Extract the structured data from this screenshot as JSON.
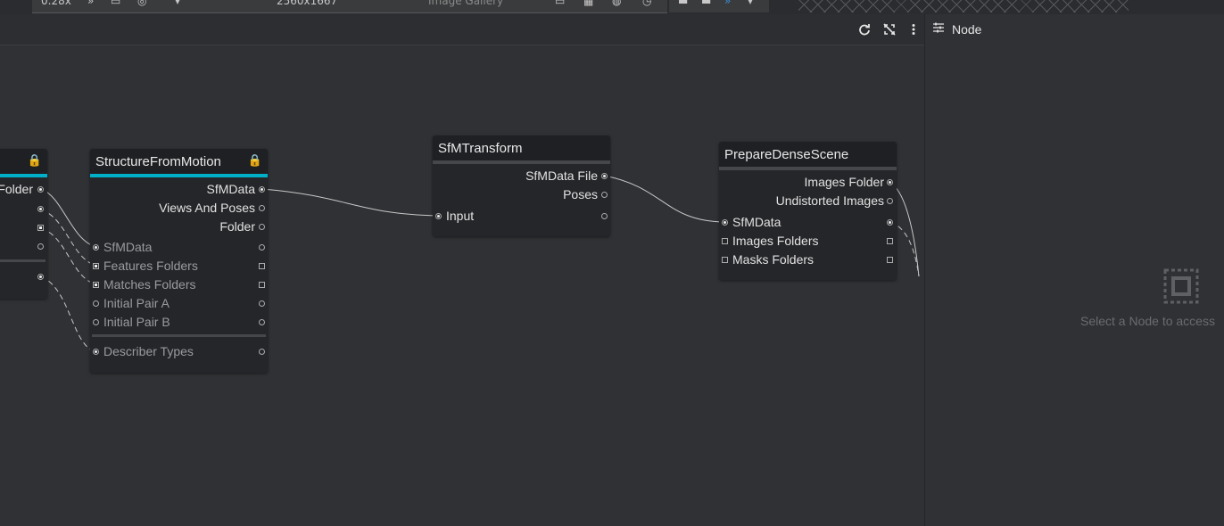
{
  "top_strip": {
    "zoom": "0.28x",
    "resolution": "2560x1667",
    "gallery_label": "Image Gallery"
  },
  "header": {
    "icons": [
      "refresh-icon",
      "link-off-icon",
      "more-vert-icon"
    ]
  },
  "right_panel": {
    "title": "Node",
    "title_icon": "tune-icon",
    "placeholder": "Select a Node to access"
  },
  "nodes": {
    "partial": {
      "outputs": [
        "Folder"
      ]
    },
    "sfm": {
      "title": "StructureFromMotion",
      "outputs": [
        "SfMData",
        "Views And Poses",
        "Folder"
      ],
      "inputs": [
        "SfMData",
        "Features Folders",
        "Matches Folders",
        "Initial Pair A",
        "Initial Pair B"
      ],
      "extra_inputs": [
        "Describer Types"
      ]
    },
    "transform": {
      "title": "SfMTransform",
      "outputs": [
        "SfMData File",
        "Poses"
      ],
      "inputs": [
        "Input"
      ]
    },
    "pds": {
      "title": "PrepareDenseScene",
      "outputs": [
        "Images Folder",
        "Undistorted Images"
      ],
      "inputs": [
        "SfMData",
        "Images Folders",
        "Masks Folders"
      ]
    }
  }
}
